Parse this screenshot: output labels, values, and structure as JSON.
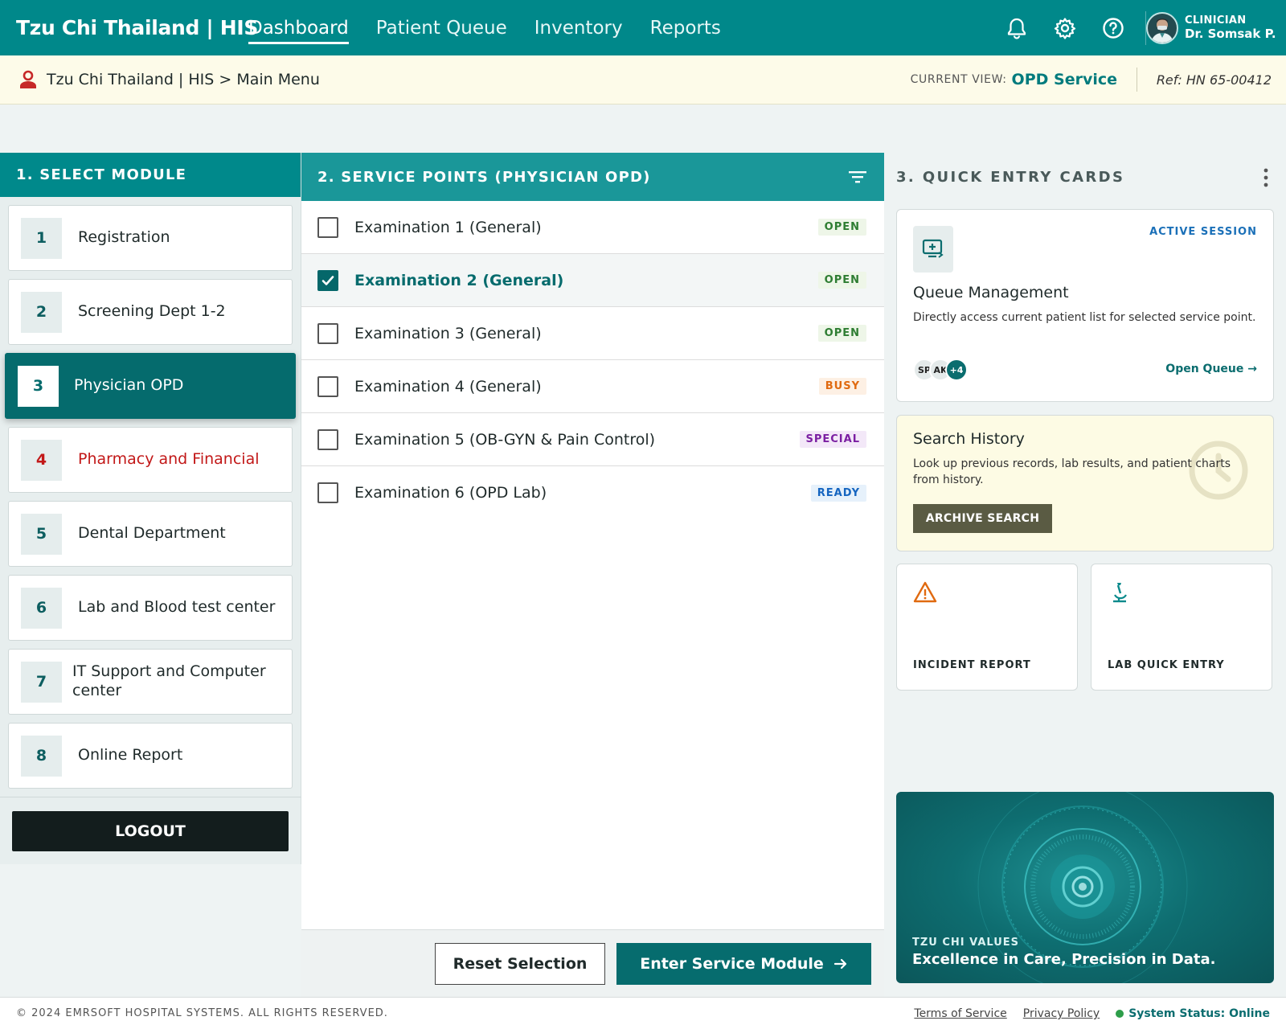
{
  "header": {
    "brand": "Tzu Chi Thailand | HIS",
    "nav": [
      "Dashboard",
      "Patient Queue",
      "Inventory",
      "Reports"
    ],
    "active_nav": "Dashboard",
    "icons": [
      "bell-icon",
      "gear-icon",
      "help-icon"
    ],
    "user": {
      "role": "CLINICIAN",
      "name": "Dr. Somsak P."
    }
  },
  "breadcrumb": {
    "text": "Tzu Chi Thailand | HIS > Main Menu",
    "current_view_label": "CURRENT VIEW:",
    "current_view_value": "OPD Service",
    "ref": "Ref: HN 65-00412"
  },
  "modules": {
    "title": "1. SELECT MODULE",
    "items": [
      {
        "num": "1",
        "label": "Registration"
      },
      {
        "num": "2",
        "label": "Screening Dept 1-2"
      },
      {
        "num": "3",
        "label": "Physician OPD"
      },
      {
        "num": "4",
        "label": "Pharmacy and Financial"
      },
      {
        "num": "5",
        "label": "Dental Department"
      },
      {
        "num": "6",
        "label": "Lab and Blood test center"
      },
      {
        "num": "7",
        "label": "IT Support and Computer center"
      },
      {
        "num": "8",
        "label": "Online Report"
      }
    ],
    "active": "3",
    "logout": "LOGOUT"
  },
  "service_points": {
    "title": "2. SERVICE POINTS (PHYSICIAN OPD)",
    "items": [
      {
        "label": "Examination 1 (General)",
        "status": "OPEN",
        "checked": false
      },
      {
        "label": "Examination 2 (General)",
        "status": "OPEN",
        "checked": true
      },
      {
        "label": "Examination 3 (General)",
        "status": "OPEN",
        "checked": false
      },
      {
        "label": "Examination 4 (General)",
        "status": "BUSY",
        "checked": false
      },
      {
        "label": "Examination 5 (OB-GYN & Pain Control)",
        "status": "SPECIAL",
        "checked": false
      },
      {
        "label": "Examination 6 (OPD Lab)",
        "status": "READY",
        "checked": false
      }
    ],
    "reset_label": "Reset Selection",
    "enter_label": "Enter Service Module"
  },
  "quick_entry": {
    "title": "3. QUICK ENTRY CARDS",
    "queue": {
      "badge": "ACTIVE SESSION",
      "title": "Queue Management",
      "desc": "Directly access current patient list for selected service point.",
      "avatars": [
        "SP",
        "AK",
        "+4"
      ],
      "link": "Open Queue →"
    },
    "search": {
      "title": "Search History",
      "desc": "Look up previous records, lab results, and patient charts from history.",
      "button": "ARCHIVE SEARCH"
    },
    "incident": {
      "label": "INCIDENT REPORT"
    },
    "lab": {
      "label": "LAB QUICK ENTRY"
    },
    "values": {
      "tag": "TZU CHI VALUES",
      "text": "Excellence in Care, Precision in Data."
    }
  },
  "footer": {
    "copyright": "© 2024 EMRSOFT HOSPITAL SYSTEMS. ALL RIGHTS RESERVED.",
    "terms": "Terms of Service",
    "privacy": "Privacy Policy",
    "status": "System Status: Online"
  },
  "colors": {
    "primary": "#00888a",
    "active_module": "#056b6d",
    "alert": "#c21818",
    "yellow_bg": "#fdfbe9"
  }
}
